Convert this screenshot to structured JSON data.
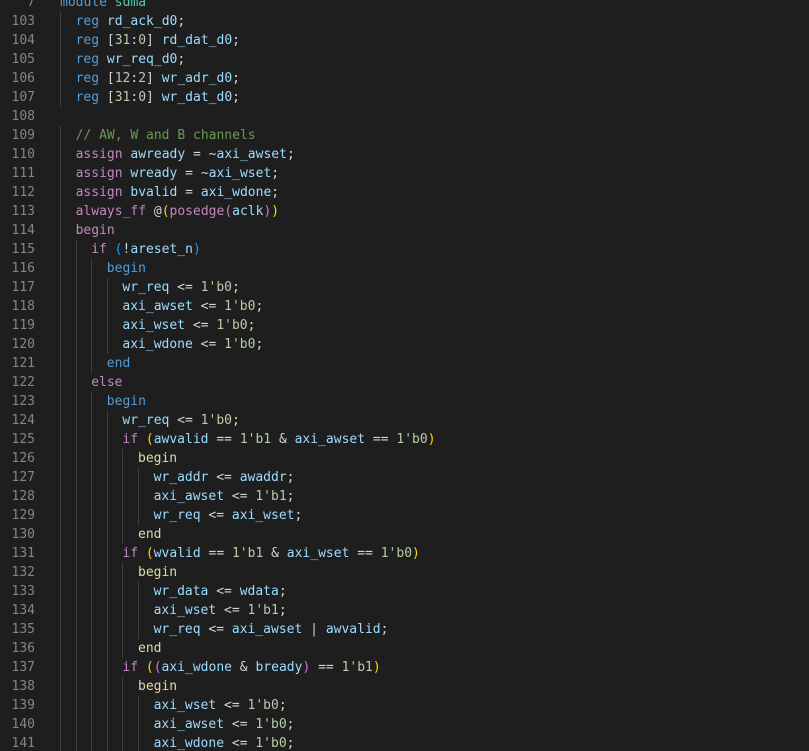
{
  "editor": {
    "language": "systemverilog",
    "colors": {
      "background": "#1e1e1e",
      "line_number": "#858585",
      "keyword": "#c586c0",
      "type": "#569cd6",
      "identifier": "#9cdcfe",
      "number": "#b5cea8",
      "comment": "#6a9955"
    },
    "lines": [
      {
        "num": "7",
        "indent": 0,
        "tokens": [
          [
            "mod",
            "module"
          ],
          [
            "op",
            " "
          ],
          [
            "modn",
            "sdma"
          ]
        ]
      },
      {
        "num": "103",
        "indent": 1,
        "tokens": [
          [
            "typ",
            "reg"
          ],
          [
            "op",
            " "
          ],
          [
            "id",
            "rd_ack_d0"
          ],
          [
            "op",
            ";"
          ]
        ]
      },
      {
        "num": "104",
        "indent": 1,
        "tokens": [
          [
            "typ",
            "reg"
          ],
          [
            "op",
            " "
          ],
          [
            "op",
            "["
          ],
          [
            "num",
            "31"
          ],
          [
            "op",
            ":"
          ],
          [
            "num",
            "0"
          ],
          [
            "op",
            "]"
          ],
          [
            "op",
            " "
          ],
          [
            "id",
            "rd_dat_d0"
          ],
          [
            "op",
            ";"
          ]
        ]
      },
      {
        "num": "105",
        "indent": 1,
        "tokens": [
          [
            "typ",
            "reg"
          ],
          [
            "op",
            " "
          ],
          [
            "id",
            "wr_req_d0"
          ],
          [
            "op",
            ";"
          ]
        ]
      },
      {
        "num": "106",
        "indent": 1,
        "tokens": [
          [
            "typ",
            "reg"
          ],
          [
            "op",
            " "
          ],
          [
            "op",
            "["
          ],
          [
            "num",
            "12"
          ],
          [
            "op",
            ":"
          ],
          [
            "num",
            "2"
          ],
          [
            "op",
            "]"
          ],
          [
            "op",
            " "
          ],
          [
            "id",
            "wr_adr_d0"
          ],
          [
            "op",
            ";"
          ]
        ]
      },
      {
        "num": "107",
        "indent": 1,
        "tokens": [
          [
            "typ",
            "reg"
          ],
          [
            "op",
            " "
          ],
          [
            "op",
            "["
          ],
          [
            "num",
            "31"
          ],
          [
            "op",
            ":"
          ],
          [
            "num",
            "0"
          ],
          [
            "op",
            "]"
          ],
          [
            "op",
            " "
          ],
          [
            "id",
            "wr_dat_d0"
          ],
          [
            "op",
            ";"
          ]
        ]
      },
      {
        "num": "108",
        "indent": 0,
        "tokens": []
      },
      {
        "num": "109",
        "indent": 1,
        "tokens": [
          [
            "cm",
            "// AW, W and B channels"
          ]
        ]
      },
      {
        "num": "110",
        "indent": 1,
        "tokens": [
          [
            "kw",
            "assign"
          ],
          [
            "op",
            " "
          ],
          [
            "id",
            "awready"
          ],
          [
            "op",
            " = ~"
          ],
          [
            "id",
            "axi_awset"
          ],
          [
            "op",
            ";"
          ]
        ]
      },
      {
        "num": "111",
        "indent": 1,
        "tokens": [
          [
            "kw",
            "assign"
          ],
          [
            "op",
            " "
          ],
          [
            "id",
            "wready"
          ],
          [
            "op",
            " = ~"
          ],
          [
            "id",
            "axi_wset"
          ],
          [
            "op",
            ";"
          ]
        ]
      },
      {
        "num": "112",
        "indent": 1,
        "tokens": [
          [
            "kw",
            "assign"
          ],
          [
            "op",
            " "
          ],
          [
            "id",
            "bvalid"
          ],
          [
            "op",
            " = "
          ],
          [
            "id",
            "axi_wdone"
          ],
          [
            "op",
            ";"
          ]
        ]
      },
      {
        "num": "113",
        "indent": 1,
        "tokens": [
          [
            "kw",
            "always_ff"
          ],
          [
            "op",
            " "
          ],
          [
            "op",
            "@"
          ],
          [
            "br1",
            "("
          ],
          [
            "kw",
            "posedge"
          ],
          [
            "br2",
            "("
          ],
          [
            "id",
            "aclk"
          ],
          [
            "br2",
            ")"
          ],
          [
            "br1",
            ")"
          ]
        ]
      },
      {
        "num": "114",
        "indent": 1,
        "tokens": [
          [
            "kw",
            "begin"
          ]
        ]
      },
      {
        "num": "115",
        "indent": 2,
        "tokens": [
          [
            "ctl",
            "if"
          ],
          [
            "op",
            " "
          ],
          [
            "br3",
            "("
          ],
          [
            "op",
            "!"
          ],
          [
            "id",
            "areset_n"
          ],
          [
            "br3",
            ")"
          ]
        ]
      },
      {
        "num": "116",
        "indent": 3,
        "tokens": [
          [
            "beg",
            "begin"
          ]
        ]
      },
      {
        "num": "117",
        "indent": 4,
        "tokens": [
          [
            "id",
            "wr_req"
          ],
          [
            "op",
            " <= "
          ],
          [
            "num",
            "1'b0"
          ],
          [
            "op",
            ";"
          ]
        ]
      },
      {
        "num": "118",
        "indent": 4,
        "tokens": [
          [
            "id",
            "axi_awset"
          ],
          [
            "op",
            " <= "
          ],
          [
            "num",
            "1'b0"
          ],
          [
            "op",
            ";"
          ]
        ]
      },
      {
        "num": "119",
        "indent": 4,
        "tokens": [
          [
            "id",
            "axi_wset"
          ],
          [
            "op",
            " <= "
          ],
          [
            "num",
            "1'b0"
          ],
          [
            "op",
            ";"
          ]
        ]
      },
      {
        "num": "120",
        "indent": 4,
        "tokens": [
          [
            "id",
            "axi_wdone"
          ],
          [
            "op",
            " <= "
          ],
          [
            "num",
            "1'b0"
          ],
          [
            "op",
            ";"
          ]
        ]
      },
      {
        "num": "121",
        "indent": 3,
        "tokens": [
          [
            "beg",
            "end"
          ]
        ]
      },
      {
        "num": "122",
        "indent": 2,
        "tokens": [
          [
            "ctl",
            "else"
          ]
        ]
      },
      {
        "num": "123",
        "indent": 3,
        "tokens": [
          [
            "beg",
            "begin"
          ]
        ]
      },
      {
        "num": "124",
        "indent": 4,
        "tokens": [
          [
            "id",
            "wr_req"
          ],
          [
            "op",
            " <= "
          ],
          [
            "num",
            "1'b0"
          ],
          [
            "op",
            ";"
          ]
        ]
      },
      {
        "num": "125",
        "indent": 4,
        "tokens": [
          [
            "ctl",
            "if"
          ],
          [
            "op",
            " "
          ],
          [
            "br1",
            "("
          ],
          [
            "id",
            "awvalid"
          ],
          [
            "op",
            " == "
          ],
          [
            "num",
            "1'b1"
          ],
          [
            "op",
            " & "
          ],
          [
            "id",
            "axi_awset"
          ],
          [
            "op",
            " == "
          ],
          [
            "num",
            "1'b0"
          ],
          [
            "br1",
            ")"
          ]
        ]
      },
      {
        "num": "126",
        "indent": 5,
        "tokens": [
          [
            "beg2",
            "begin"
          ]
        ]
      },
      {
        "num": "127",
        "indent": 6,
        "tokens": [
          [
            "id",
            "wr_addr"
          ],
          [
            "op",
            " <= "
          ],
          [
            "id",
            "awaddr"
          ],
          [
            "op",
            ";"
          ]
        ]
      },
      {
        "num": "128",
        "indent": 6,
        "tokens": [
          [
            "id",
            "axi_awset"
          ],
          [
            "op",
            " <= "
          ],
          [
            "num",
            "1'b1"
          ],
          [
            "op",
            ";"
          ]
        ]
      },
      {
        "num": "129",
        "indent": 6,
        "tokens": [
          [
            "id",
            "wr_req"
          ],
          [
            "op",
            " <= "
          ],
          [
            "id",
            "axi_wset"
          ],
          [
            "op",
            ";"
          ]
        ]
      },
      {
        "num": "130",
        "indent": 5,
        "tokens": [
          [
            "beg2",
            "end"
          ]
        ]
      },
      {
        "num": "131",
        "indent": 4,
        "tokens": [
          [
            "ctl",
            "if"
          ],
          [
            "op",
            " "
          ],
          [
            "br1",
            "("
          ],
          [
            "id",
            "wvalid"
          ],
          [
            "op",
            " == "
          ],
          [
            "num",
            "1'b1"
          ],
          [
            "op",
            " & "
          ],
          [
            "id",
            "axi_wset"
          ],
          [
            "op",
            " == "
          ],
          [
            "num",
            "1'b0"
          ],
          [
            "br1",
            ")"
          ]
        ]
      },
      {
        "num": "132",
        "indent": 5,
        "tokens": [
          [
            "beg2",
            "begin"
          ]
        ]
      },
      {
        "num": "133",
        "indent": 6,
        "tokens": [
          [
            "id",
            "wr_data"
          ],
          [
            "op",
            " <= "
          ],
          [
            "id",
            "wdata"
          ],
          [
            "op",
            ";"
          ]
        ]
      },
      {
        "num": "134",
        "indent": 6,
        "tokens": [
          [
            "id",
            "axi_wset"
          ],
          [
            "op",
            " <= "
          ],
          [
            "num",
            "1'b1"
          ],
          [
            "op",
            ";"
          ]
        ]
      },
      {
        "num": "135",
        "indent": 6,
        "tokens": [
          [
            "id",
            "wr_req"
          ],
          [
            "op",
            " <= "
          ],
          [
            "id",
            "axi_awset"
          ],
          [
            "op",
            " | "
          ],
          [
            "id",
            "awvalid"
          ],
          [
            "op",
            ";"
          ]
        ]
      },
      {
        "num": "136",
        "indent": 5,
        "tokens": [
          [
            "beg2",
            "end"
          ]
        ]
      },
      {
        "num": "137",
        "indent": 4,
        "tokens": [
          [
            "ctl",
            "if"
          ],
          [
            "op",
            " "
          ],
          [
            "br1",
            "("
          ],
          [
            "br2",
            "("
          ],
          [
            "id",
            "axi_wdone"
          ],
          [
            "op",
            " & "
          ],
          [
            "id",
            "bready"
          ],
          [
            "br2",
            ")"
          ],
          [
            "op",
            " == "
          ],
          [
            "num",
            "1'b1"
          ],
          [
            "br1",
            ")"
          ]
        ]
      },
      {
        "num": "138",
        "indent": 5,
        "tokens": [
          [
            "beg2",
            "begin"
          ]
        ]
      },
      {
        "num": "139",
        "indent": 6,
        "tokens": [
          [
            "id",
            "axi_wset"
          ],
          [
            "op",
            " <= "
          ],
          [
            "num",
            "1'b0"
          ],
          [
            "op",
            ";"
          ]
        ]
      },
      {
        "num": "140",
        "indent": 6,
        "tokens": [
          [
            "id",
            "axi_awset"
          ],
          [
            "op",
            " <= "
          ],
          [
            "num",
            "1'b0"
          ],
          [
            "op",
            ";"
          ]
        ]
      },
      {
        "num": "141",
        "indent": 6,
        "tokens": [
          [
            "id",
            "axi_wdone"
          ],
          [
            "op",
            " <= "
          ],
          [
            "num",
            "1'b0"
          ],
          [
            "op",
            ";"
          ]
        ]
      }
    ]
  }
}
